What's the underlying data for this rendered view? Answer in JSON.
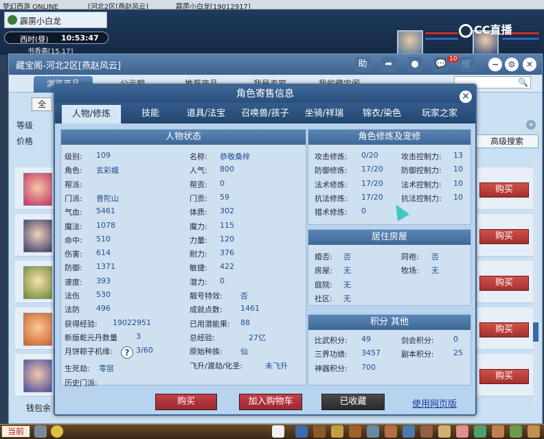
{
  "browser": {
    "tabs": [
      "梦幻西游 ONLINE",
      "[河北2区[燕赵风云]",
      "霹雳小白龙[19012917]"
    ]
  },
  "hud": {
    "char_name": "霹雳小白龙",
    "time_label": "西时(昼)",
    "clock": "10:53:47",
    "sub_name": "书香斋[15,17]"
  },
  "watermark": {
    "label": "CC直播"
  },
  "shop": {
    "title": "藏宝阁-河北2区[燕赵风云]",
    "header_icons": {
      "help": "助"
    },
    "notifications": "10",
    "tabs": [
      "浏览商品",
      "公示期",
      "推荐商品",
      "我是卖家",
      "我的藏宝阁"
    ],
    "filter_all": "全",
    "filter_level": "等级",
    "filter_price": "价格",
    "advanced_search": "高级搜索",
    "buy_label": "购买",
    "money_label": "钱包余"
  },
  "modal": {
    "title": "角色寄售信息",
    "tabs": [
      "人物/修炼",
      "技能",
      "道具/法宝",
      "召唤兽/孩子",
      "坐骑/祥瑞",
      "锦衣/染色",
      "玩家之家"
    ],
    "status_title": "人物状态",
    "status_left": [
      {
        "label": "级别:",
        "value": "109"
      },
      {
        "label": "角色:",
        "value": "玄彩娥"
      },
      {
        "label": "帮派:",
        "value": ""
      },
      {
        "label": "门派:",
        "value": "普陀山"
      },
      {
        "label": "气血:",
        "value": "5461"
      },
      {
        "label": "魔法:",
        "value": "1078"
      },
      {
        "label": "命中:",
        "value": "510"
      },
      {
        "label": "伤害:",
        "value": "614"
      },
      {
        "label": "防御:",
        "value": "1371"
      },
      {
        "label": "速度:",
        "value": "393"
      },
      {
        "label": "法伤",
        "value": "530"
      },
      {
        "label": "法防",
        "value": "496"
      },
      {
        "label": "获得经验:",
        "value": "19022951"
      },
      {
        "label": "新版乾元丹数量",
        "value": "3"
      },
      {
        "label": "月饼粽子机缘:",
        "value": "3/60"
      },
      {
        "label": "生死劫:",
        "value": "零层"
      },
      {
        "label": "历史门派:",
        "value": ""
      }
    ],
    "status_right": [
      {
        "label": "名称:",
        "value": "恭敬桑梓"
      },
      {
        "label": "人气:",
        "value": "800"
      },
      {
        "label": "帮贡:",
        "value": "0"
      },
      {
        "label": "门贡:",
        "value": "59"
      },
      {
        "label": "体质:",
        "value": "302"
      },
      {
        "label": "魔力:",
        "value": "115"
      },
      {
        "label": "力量:",
        "value": "120"
      },
      {
        "label": "耐力:",
        "value": "376"
      },
      {
        "label": "敏捷:",
        "value": "422"
      },
      {
        "label": "潜力:",
        "value": "0"
      },
      {
        "label": "靓号特效:",
        "value": "否"
      },
      {
        "label": "成就点数:",
        "value": "1461"
      },
      {
        "label": "已用潜能果:",
        "value": "88"
      },
      {
        "label": "总经验:",
        "value": "27亿"
      },
      {
        "label": "原始种族:",
        "value": "仙"
      },
      {
        "label": "飞升/渡劫/化圣:",
        "value": "未飞升"
      }
    ],
    "help_mark": "?",
    "cultivation_title": "角色修炼及宠修",
    "cultivation": [
      {
        "l1": "攻击修炼:",
        "v1": "0/20",
        "l2": "攻击控制力:",
        "v2": "13"
      },
      {
        "l1": "防御修炼:",
        "v1": "17/20",
        "l2": "防御控制力:",
        "v2": "10"
      },
      {
        "l1": "法术修炼:",
        "v1": "17/20",
        "l2": "法术控制力:",
        "v2": "10"
      },
      {
        "l1": "抗法修炼:",
        "v1": "17/20",
        "l2": "抗法控制力:",
        "v2": "10"
      },
      {
        "l1": "猎术修炼:",
        "v1": "0",
        "l2": "",
        "v2": ""
      }
    ],
    "housing_title": "居住房屋",
    "housing": [
      {
        "l1": "婚否:",
        "v1": "否",
        "l2": "同袍:",
        "v2": "否"
      },
      {
        "l1": "房屋:",
        "v1": "无",
        "l2": "牧场:",
        "v2": "无"
      },
      {
        "l1": "庭院:",
        "v1": "无",
        "l2": "",
        "v2": ""
      },
      {
        "l1": "社区:",
        "v1": "无",
        "l2": "",
        "v2": ""
      }
    ],
    "score_title": "积分 其他",
    "scores": [
      {
        "l1": "比武积分:",
        "v1": "49",
        "l2": "剑会积分:",
        "v2": "0"
      },
      {
        "l1": "三界功绩:",
        "v1": "3457",
        "l2": "副本积分:",
        "v2": "25"
      },
      {
        "l1": "神器积分:",
        "v1": "700",
        "l2": "",
        "v2": ""
      }
    ],
    "btn_buy": "购买",
    "btn_cart": "加入购物车",
    "btn_favorited": "已收藏",
    "link_web": "使用网页版"
  },
  "bottom": {
    "now": "当前"
  },
  "colors": {
    "accent": "#3e6898",
    "buy": "#b0302c",
    "value": "#1d4f8c"
  }
}
